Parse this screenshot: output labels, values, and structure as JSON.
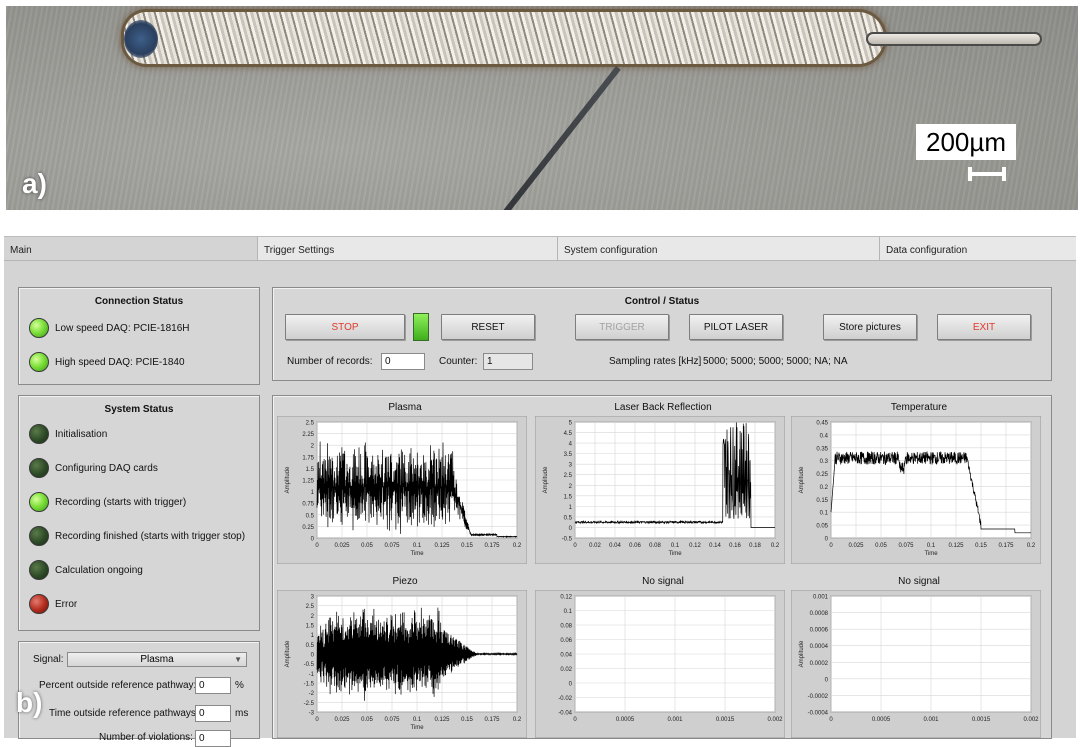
{
  "micrograph": {
    "panel_label": "a)",
    "scale_label": "200µm"
  },
  "app": {
    "panel_label": "b)",
    "tabs": [
      "Main",
      "Trigger Settings",
      "System configuration",
      "Data configuration"
    ],
    "connection": {
      "title": "Connection Status",
      "items": [
        {
          "label": "Low speed DAQ: PCIE-1816H",
          "state": "on"
        },
        {
          "label": "High speed DAQ: PCIE-1840",
          "state": "on"
        }
      ]
    },
    "system": {
      "title": "System Status",
      "items": [
        {
          "label": "Initialisation",
          "state": "off"
        },
        {
          "label": "Configuring DAQ cards",
          "state": "off"
        },
        {
          "label": "Recording (starts with trigger)",
          "state": "on"
        },
        {
          "label": "Recording finished (starts with trigger stop)",
          "state": "off"
        },
        {
          "label": "Calculation ongoing",
          "state": "off"
        },
        {
          "label": "Error",
          "state": "err"
        }
      ]
    },
    "signal_panel": {
      "signal_label": "Signal:",
      "signal_value": "Plasma",
      "percent_label": "Percent outside reference pathway:",
      "percent_value": "0",
      "percent_unit": "%",
      "time_label": "Time outside reference pathways:",
      "time_value": "0",
      "time_unit": "ms",
      "violations_label": "Number of violations:",
      "violations_value": "0"
    },
    "control": {
      "title": "Control / Status",
      "stop": "STOP",
      "reset": "RESET",
      "trigger": "TRIGGER",
      "pilot_laser": "PILOT LASER",
      "store_pictures": "Store pictures",
      "exit": "EXIT",
      "records_label": "Number of records:",
      "records_value": "0",
      "counter_label": "Counter:",
      "counter_value": "1",
      "sampling_label": "Sampling rates [kHz]",
      "sampling_value": "5000; 5000; 5000; 5000; NA; NA"
    },
    "plots": [
      {
        "title": "Plasma",
        "ylabel": "Amplitude",
        "xlabel": "Time",
        "yticks": [
          "2.5",
          "2.25",
          "2",
          "1.75",
          "1.5",
          "1.25",
          "1",
          "0.75",
          "0.5",
          "0.25",
          "0"
        ],
        "xticks": [
          "0",
          "0.025",
          "0.05",
          "0.075",
          "0.1",
          "0.125",
          "0.15",
          "0.175",
          "0.2"
        ]
      },
      {
        "title": "Laser Back Reflection",
        "ylabel": "Amplitude",
        "xlabel": "Time",
        "yticks": [
          "5",
          "4.5",
          "4",
          "3.5",
          "3",
          "2.5",
          "2",
          "1.5",
          "1",
          "0.5",
          "0",
          "-0.5"
        ],
        "xticks": [
          "0",
          "0.02",
          "0.04",
          "0.06",
          "0.08",
          "0.1",
          "0.12",
          "0.14",
          "0.16",
          "0.18",
          "0.2"
        ]
      },
      {
        "title": "Temperature",
        "ylabel": "Amplitude",
        "xlabel": "Time",
        "yticks": [
          "0.45",
          "0.4",
          "0.35",
          "0.3",
          "0.25",
          "0.2",
          "0.15",
          "0.1",
          "0.05",
          "0"
        ],
        "xticks": [
          "0",
          "0.025",
          "0.05",
          "0.075",
          "0.1",
          "0.125",
          "0.15",
          "0.175",
          "0.2"
        ]
      },
      {
        "title": "Piezo",
        "ylabel": "Amplitude",
        "xlabel": "Time",
        "yticks": [
          "3",
          "2.5",
          "2",
          "1.5",
          "1",
          "0.5",
          "0",
          "-0.5",
          "-1",
          "-1.5",
          "-2",
          "-2.5",
          "-3"
        ],
        "xticks": [
          "0",
          "0.025",
          "0.05",
          "0.075",
          "0.1",
          "0.125",
          "0.15",
          "0.175",
          "0.2"
        ]
      },
      {
        "title": "No signal",
        "ylabel": "",
        "xlabel": "",
        "yticks": [
          "0.12",
          "0.1",
          "0.08",
          "0.06",
          "0.04",
          "0.02",
          "0",
          "-0.02",
          "-0.04"
        ],
        "xticks": [
          "0",
          "0.0005",
          "0.001",
          "0.0015",
          "0.002"
        ]
      },
      {
        "title": "No signal",
        "ylabel": "Amplitude",
        "xlabel": "",
        "yticks": [
          "0.001",
          "0.0008",
          "0.0006",
          "0.0004",
          "0.0002",
          "0",
          "-0.0002",
          "-0.0004"
        ],
        "xticks": [
          "0",
          "0.0005",
          "0.001",
          "0.0015",
          "0.002"
        ]
      }
    ]
  }
}
